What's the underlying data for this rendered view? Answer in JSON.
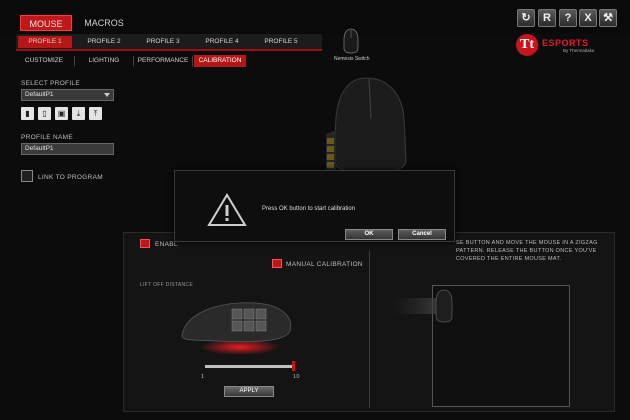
{
  "top_tabs": {
    "mouse": "MOUSE",
    "macros": "MACROS"
  },
  "window_buttons": {
    "refresh": "↻",
    "reset": "R",
    "help": "?",
    "close": "X",
    "tools": "⚒"
  },
  "profile_tabs": [
    "PROFILE 1",
    "PROFILE 2",
    "PROFILE 3",
    "PROFILE 4",
    "PROFILE 5"
  ],
  "sub_tabs": [
    "CUSTOMIZE",
    "LIGHTING",
    "PERFORMANCE",
    "CALIBRATION"
  ],
  "logo": {
    "brand": "ESPORTS",
    "by": "By Thermaltake"
  },
  "device_label": "Nemesis Switch",
  "left_panel": {
    "select_profile_label": "SELECT PROFILE",
    "select_profile_value": "DefaultP1",
    "profile_name_label": "PROFILE NAME",
    "profile_name_value": "DefaultP1",
    "link_to_program_label": "LINK TO PROGRAM"
  },
  "calibration": {
    "enable_label": "ENABL",
    "manual_calibration_label": "MANUAL CALIBRATION",
    "lift_off_label": "LIFT OFF DISTANCE",
    "instructions": "SE BUTTON AND MOVE THE MOUSE IN A ZIGZAG PATTERN. RELEASE THE BUTTON ONCE YOU'VE COVERED THE ENTIRE MOUSE MAT.",
    "slider_min": "1",
    "slider_max": "10",
    "slider_value": 10,
    "apply_label": "APPLY"
  },
  "dialog": {
    "message": "Press OK button to start calibration",
    "ok_label": "OK",
    "cancel_label": "Cancel"
  },
  "colors": {
    "accent": "#b51616",
    "background": "#0c0c0c"
  }
}
